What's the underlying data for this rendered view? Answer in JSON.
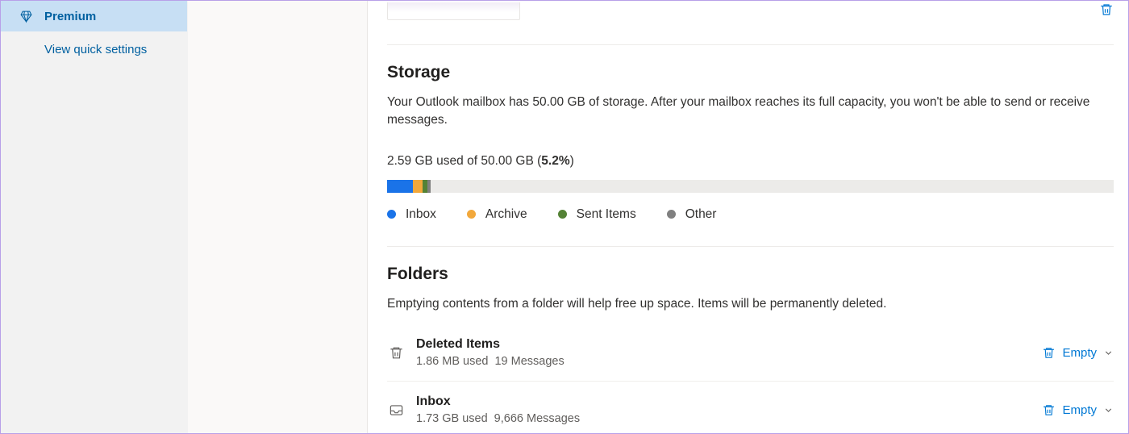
{
  "sidebar": {
    "premium_label": "Premium",
    "quick_settings_label": "View quick settings"
  },
  "storage": {
    "title": "Storage",
    "description": "Your Outlook mailbox has 50.00 GB of storage. After your mailbox reaches its full capacity, you won't be able to send or receive messages.",
    "used_label_prefix": "2.59 GB used of 50.00 GB (",
    "used_percent": "5.2%",
    "used_label_suffix": ")",
    "segments": [
      {
        "label": "Inbox",
        "color": "#1a73e8",
        "width_pct": 3.6
      },
      {
        "label": "Archive",
        "color": "#f2a83b",
        "width_pct": 1.3
      },
      {
        "label": "Sent Items",
        "color": "#548235",
        "width_pct": 0.6
      },
      {
        "label": "Other",
        "color": "#808080",
        "width_pct": 0.5
      }
    ]
  },
  "folders": {
    "title": "Folders",
    "description": "Emptying contents from a folder will help free up space. Items will be permanently deleted.",
    "items": [
      {
        "name": "Deleted Items",
        "used": "1.86 MB used",
        "messages": "19 Messages",
        "icon": "trash"
      },
      {
        "name": "Inbox",
        "used": "1.73 GB used",
        "messages": "9,666 Messages",
        "icon": "inbox"
      }
    ],
    "empty_label": "Empty"
  }
}
